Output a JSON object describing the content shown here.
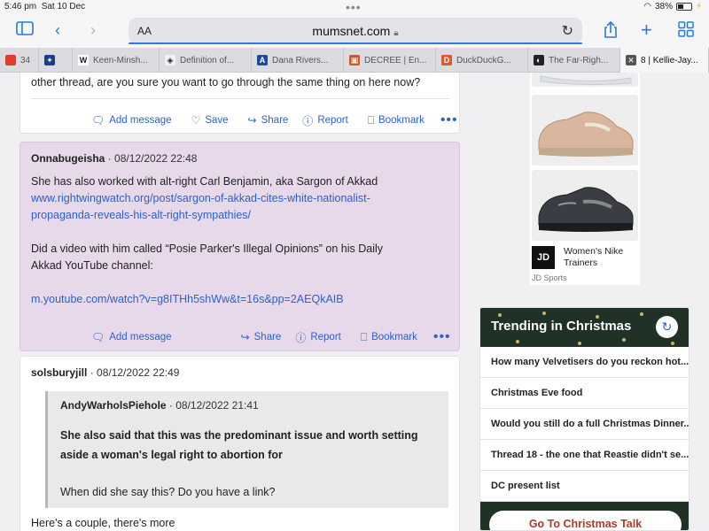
{
  "status": {
    "time": "5:46 pm",
    "date": "Sat 10 Dec",
    "battery": "38%"
  },
  "toolbar": {
    "text_size": "AA",
    "url": "mumsnet.com"
  },
  "tabs": [
    {
      "label": "34",
      "color": "#e23c2f",
      "glyph": ""
    },
    {
      "label": "",
      "color": "#1c3e8a",
      "glyph": "✦"
    },
    {
      "label": "Keen-Minsh...",
      "color": "#ffffff",
      "glyph": "W"
    },
    {
      "label": "Definition of...",
      "color": "#f1f1f1",
      "glyph": "◈"
    },
    {
      "label": "Dana Rivers...",
      "color": "#1e4b9b",
      "glyph": "A"
    },
    {
      "label": "DECREE | En...",
      "color": "#d0572a",
      "glyph": "▣"
    },
    {
      "label": "DuckDuckG...",
      "color": "#de5833",
      "glyph": "D"
    },
    {
      "label": "The Far-Righ...",
      "color": "#222222",
      "glyph": "◐"
    },
    {
      "label": "8 | Kellie-Jay...",
      "color": "#555555",
      "glyph": "✕"
    }
  ],
  "post_top": {
    "text": "other thread, are you sure you want to go through the same thing on here now?",
    "actions": [
      "Add message",
      "Save",
      "Share",
      "Report",
      "Bookmark"
    ]
  },
  "post2": {
    "user": "Onnabugeisha",
    "date": "08/12/2022 22:48",
    "line1": "She has also worked with alt-right Carl Benjamin, aka Sargon of Akkad",
    "link1": "www.rightwingwatch.org/post/sargon-of-akkad-cites-white-nationalist-propaganda-reveals-his-alt-right-sympathies/",
    "line2": "Did a video with him called “Posie Parker's Illegal Opinions” on his Daily Akkad YouTube channel:",
    "link2": "m.youtube.com/watch?v=g8ITHh5shWw&t=16s&pp=2AEQkAIB",
    "actions": [
      "Add message",
      "Share",
      "Report",
      "Bookmark"
    ]
  },
  "post3": {
    "user": "solsburyjill",
    "date": "08/12/2022 22:49",
    "quote_user": "AndyWarholsPiehole",
    "quote_date": "08/12/2022 21:41",
    "quote_bold": "She also said that this was the predominant issue and worth setting aside a woman's legal right to abortion for",
    "quote_text": "When did she say this? Do you have a link?",
    "reply": "Here's a couple, there's more"
  },
  "ad": {
    "title": "Women's Nike Trainers",
    "brand": "JD Sports",
    "logo": "JD"
  },
  "trending": {
    "title": "Trending in Christmas",
    "items": [
      "How many Velvetisers do you reckon hot...",
      "Christmas Eve food",
      "Would you still do a full Christmas Dinner...",
      "Thread 18 - the one that Reastie didn't se...",
      "DC present list"
    ],
    "button": "Go To Christmas Talk"
  }
}
